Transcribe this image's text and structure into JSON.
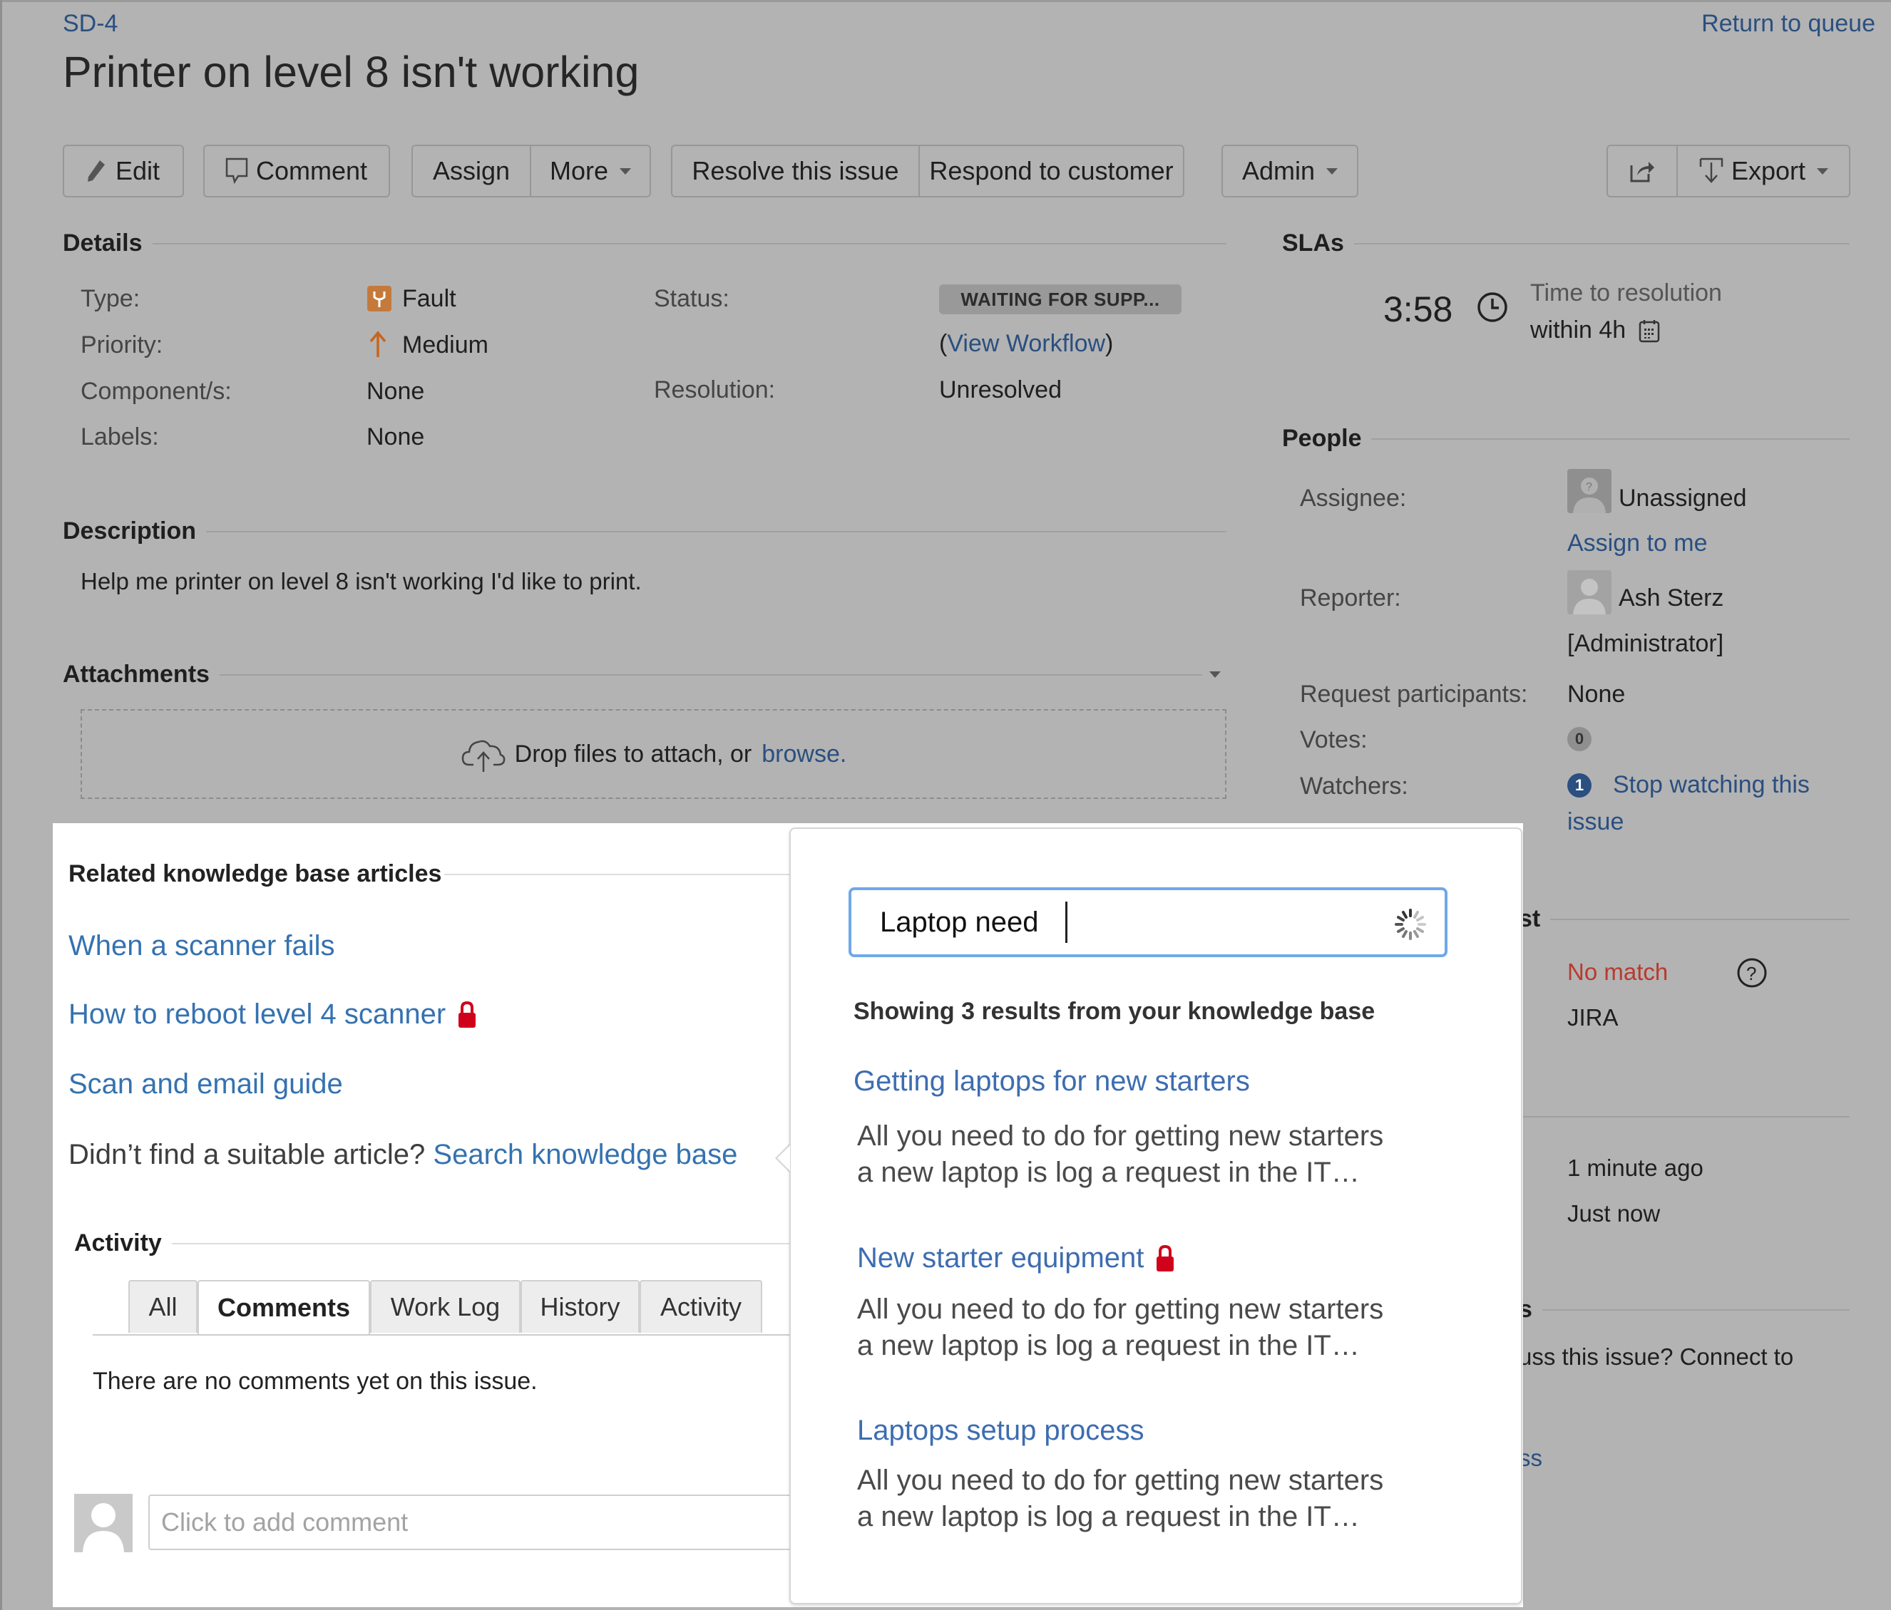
{
  "header": {
    "issue_key": "SD-4",
    "title": "Printer on level 8 isn't working",
    "return_link": "Return to queue"
  },
  "toolbar": {
    "edit": "Edit",
    "comment": "Comment",
    "assign": "Assign",
    "more": "More",
    "resolve": "Resolve this issue",
    "respond": "Respond to customer",
    "admin": "Admin",
    "export": "Export"
  },
  "details": {
    "heading": "Details",
    "type_label": "Type:",
    "type_value": "Fault",
    "priority_label": "Priority:",
    "priority_value": "Medium",
    "components_label": "Component/s:",
    "components_value": "None",
    "labels_label": "Labels:",
    "labels_value": "None",
    "status_label": "Status:",
    "status_value": "WAITING FOR SUPP...",
    "view_workflow_open": "(",
    "view_workflow": "View Workflow",
    "view_workflow_close": ")",
    "resolution_label": "Resolution:",
    "resolution_value": "Unresolved"
  },
  "description": {
    "heading": "Description",
    "text": "Help me printer on level 8 isn't working I'd like to print."
  },
  "attachments": {
    "heading": "Attachments",
    "drop_text": "Drop files to attach, or",
    "browse": "browse."
  },
  "slas": {
    "heading": "SLAs",
    "time": "3:58",
    "name": "Time to resolution",
    "goal": "within 4h"
  },
  "people": {
    "heading": "People",
    "assignee_label": "Assignee:",
    "assignee_value": "Unassigned",
    "assign_to_me": "Assign to me",
    "reporter_label": "Reporter:",
    "reporter_name": "Ash Sterz",
    "reporter_role": "[Administrator]",
    "participants_label": "Request participants:",
    "participants_value": "None",
    "votes_label": "Votes:",
    "votes_count": "0",
    "watchers_label": "Watchers:",
    "watchers_count": "1",
    "stop_watching_line1": "Stop watching this",
    "stop_watching_line2": "issue"
  },
  "right_partial": {
    "section1_heading_tail": "st",
    "no_match": "No match",
    "channel": "JIRA",
    "created": "1 minute ago",
    "updated": "Just now",
    "section2_heading_tail": "s",
    "connect_text": "uss this issue? Connect to",
    "link_tail": "ss"
  },
  "kb_panel": {
    "heading": "Related knowledge base articles",
    "articles": [
      {
        "title": "When a scanner fails",
        "locked": false
      },
      {
        "title": "How to reboot level 4 scanner",
        "locked": true
      },
      {
        "title": "Scan and email guide",
        "locked": false
      }
    ],
    "not_found_text": "Didn’t find a suitable article?",
    "search_link": "Search knowledge base"
  },
  "activity": {
    "heading": "Activity",
    "tabs": [
      "All",
      "Comments",
      "Work Log",
      "History",
      "Activity"
    ],
    "active_tab": "Comments",
    "empty_text": "There are no comments yet on this issue.",
    "comment_placeholder": "Click to add comment"
  },
  "kb_search": {
    "query": "Laptop need",
    "results_summary": "Showing 3 results from your knowledge base",
    "results": [
      {
        "title": "Getting laptops for new starters",
        "locked": false,
        "excerpt_line1": "All you need to do for getting new starters",
        "excerpt_line2": "a new laptop is log a request in the IT…"
      },
      {
        "title": "New starter equipment",
        "locked": true,
        "excerpt_line1": "All you need to do for getting new starters",
        "excerpt_line2": "a new laptop is log a request in the IT…"
      },
      {
        "title": "Laptops setup process",
        "locked": false,
        "excerpt_line1": "All you need to do for getting new starters",
        "excerpt_line2": "a new laptop is log a request in the IT…"
      }
    ]
  },
  "colors": {
    "link": "#2a4f80",
    "kb_link": "#3572b0",
    "lock": "#d0021b",
    "no_match": "#b83a2e",
    "focus_border": "#6fa8e8",
    "dim_background": "#b3b3b3"
  }
}
